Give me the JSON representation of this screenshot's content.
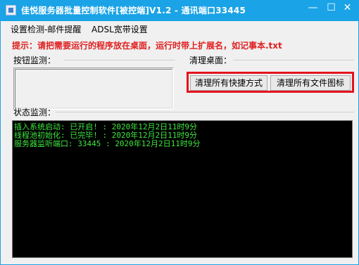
{
  "window": {
    "title": "佳悦服务器批量控制软件[被控端]V1.2 - 通讯端口33445",
    "minimize_glyph": "—",
    "maximize_glyph": "☐",
    "close_glyph": "✕"
  },
  "menu": {
    "items": [
      "设置检测-邮件提醒",
      "ADSL宽带设置"
    ]
  },
  "hint": "提示：请把需要运行的程序放在桌面，运行时带上扩展名，如记事本.txt",
  "button_monitor": {
    "label": "按钮监测："
  },
  "clean_desktop": {
    "label": "清理桌面：",
    "buttons": [
      "清理所有快捷方式",
      "清理所有文件图标"
    ]
  },
  "status_monitor": {
    "label": "状态监测：",
    "lines": [
      "插入系统启动: 已开启!  : 2020年12月2日11时9分",
      "线程池初始化: 已完毕!  : 2020年12月2日11时9分",
      "服务器监听端口: 33445 : 2020年12月2日11时9分"
    ]
  },
  "colors": {
    "titlebar": "#1aa3e6",
    "hint": "#e02020",
    "highlight_border": "#e5141c",
    "console_text": "#3fe63f",
    "console_bg": "#000000"
  }
}
